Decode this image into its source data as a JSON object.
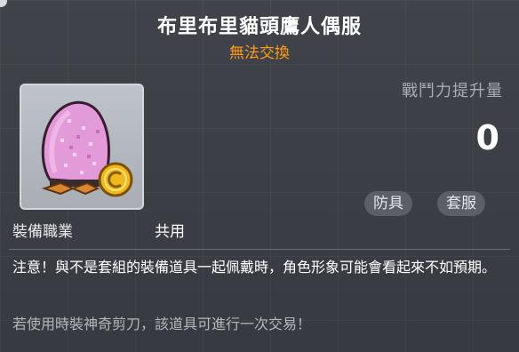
{
  "item": {
    "name": "布里布里貓頭鷹人偶服",
    "trade_status": "無法交換",
    "trade_status_color": "#ff9b1a",
    "icon": "pink-owl-costume-icon",
    "coin_icon": "gold-coin-icon"
  },
  "stats": {
    "power_label": "戰鬥力提升量",
    "power_value": "0"
  },
  "tags": {
    "armor": "防具",
    "set": "套服"
  },
  "job": {
    "label": "裝備職業",
    "value": "共用"
  },
  "description": {
    "notice": "注意！與不是套組的裝備道具一起佩戴時，角色形象可能會看起來不如預期。",
    "trade_note": "若使用時裝神奇剪刀，該道具可進行一次交易！"
  }
}
